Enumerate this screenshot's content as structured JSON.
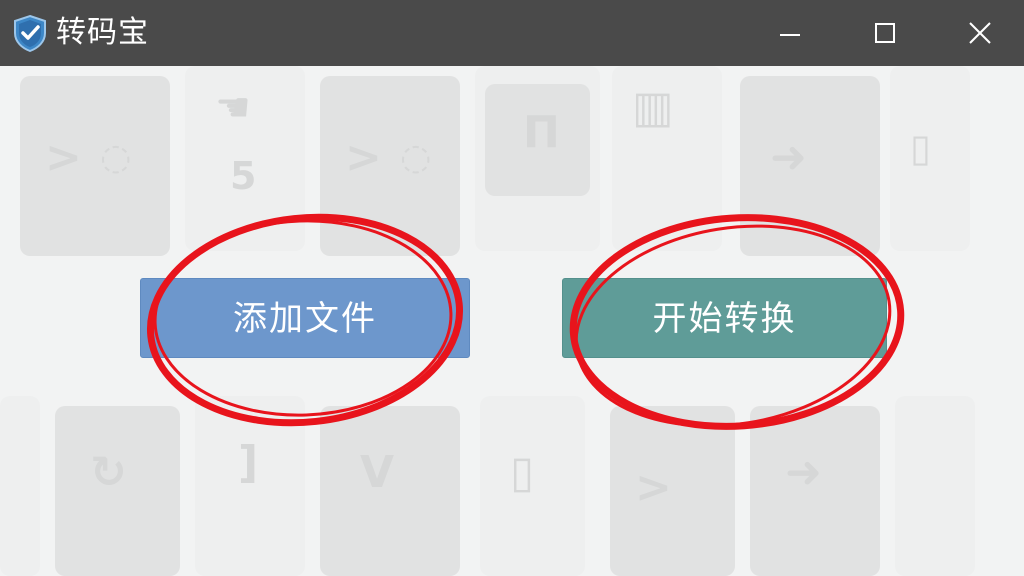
{
  "window": {
    "title": "转码宝",
    "icon": "shield-check-icon",
    "controls": {
      "minimize": "minimize-icon",
      "maximize": "maximize-icon",
      "close": "close-icon"
    }
  },
  "actions": {
    "add_files_label": "添加文件",
    "start_convert_label": "开始转换"
  },
  "colors": {
    "titlebar": "#4a4a4a",
    "add_button": "#6d97cc",
    "convert_button": "#5f9c98",
    "annotation_ring": "#e8141c",
    "background": "#f2f3f3"
  }
}
